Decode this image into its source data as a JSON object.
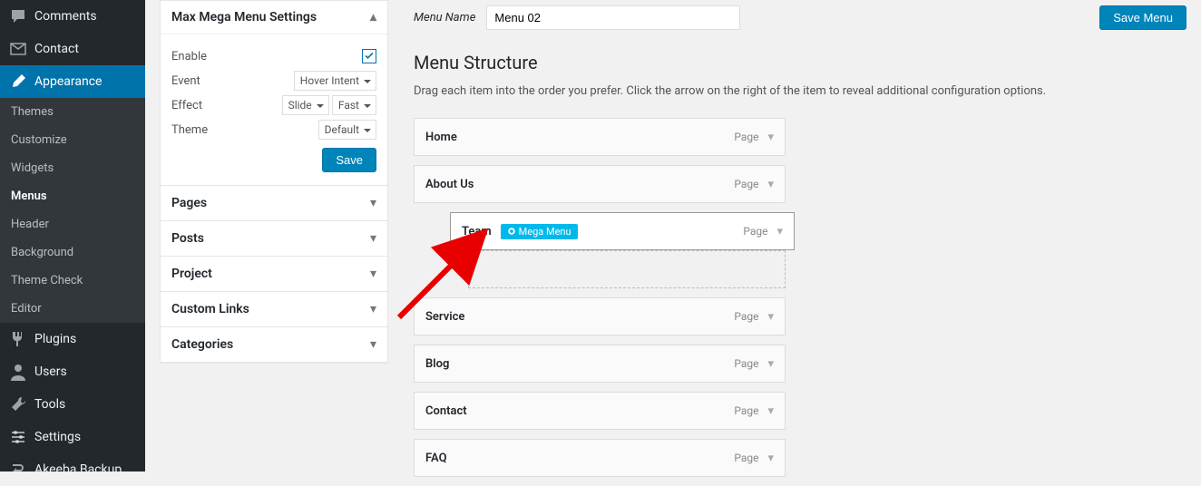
{
  "sidebar": {
    "items": [
      {
        "label": "Comments",
        "icon": "comment"
      },
      {
        "label": "Contact",
        "icon": "mail"
      },
      {
        "label": "Appearance",
        "icon": "brush",
        "active": true
      },
      {
        "label": "Plugins",
        "icon": "plug"
      },
      {
        "label": "Users",
        "icon": "user"
      },
      {
        "label": "Tools",
        "icon": "wrench"
      },
      {
        "label": "Settings",
        "icon": "sliders"
      },
      {
        "label": "Akeeba Backup",
        "icon": "backup"
      }
    ],
    "appearance_sub": [
      {
        "label": "Themes"
      },
      {
        "label": "Customize"
      },
      {
        "label": "Widgets"
      },
      {
        "label": "Menus",
        "active": true
      },
      {
        "label": "Header"
      },
      {
        "label": "Background"
      },
      {
        "label": "Theme Check"
      },
      {
        "label": "Editor"
      }
    ]
  },
  "settings_panel": {
    "title": "Max Mega Menu Settings",
    "enable_label": "Enable",
    "enable_checked": true,
    "event_label": "Event",
    "event_value": "Hover Intent",
    "effect_label": "Effect",
    "effect_value1": "Slide",
    "effect_value2": "Fast",
    "theme_label": "Theme",
    "theme_value": "Default",
    "save_label": "Save",
    "accordion": [
      "Pages",
      "Posts",
      "Project",
      "Custom Links",
      "Categories"
    ]
  },
  "main": {
    "menu_name_label": "Menu Name",
    "menu_name_value": "Menu 02",
    "save_menu_label": "Save Menu",
    "structure_title": "Menu Structure",
    "structure_desc": "Drag each item into the order you prefer. Click the arrow on the right of the item to reveal additional configuration options.",
    "items": [
      {
        "title": "Home",
        "type": "Page"
      },
      {
        "title": "About Us",
        "type": "Page"
      },
      {
        "title": "Team",
        "type": "Page",
        "sub": true,
        "badge": "Mega Menu",
        "drag": true
      },
      {
        "title": "Service",
        "type": "Page"
      },
      {
        "title": "Blog",
        "type": "Page"
      },
      {
        "title": "Contact",
        "type": "Page"
      },
      {
        "title": "FAQ",
        "type": "Page"
      }
    ]
  }
}
